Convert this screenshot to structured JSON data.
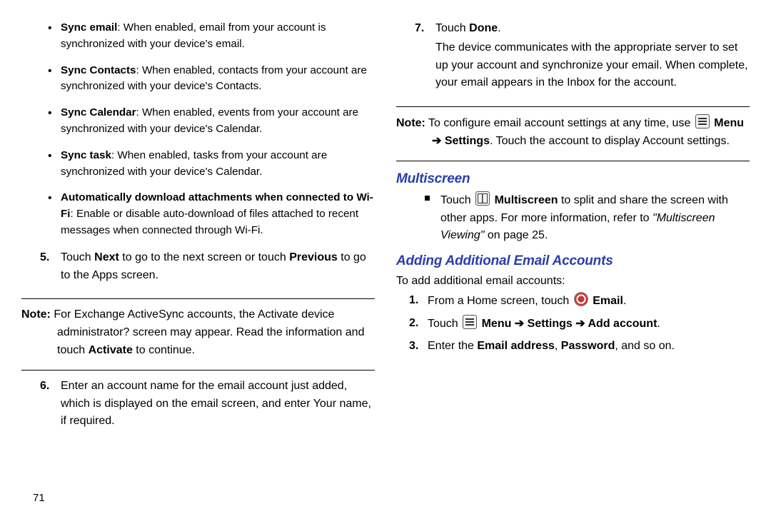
{
  "pageNumber": "71",
  "left": {
    "bullets": [
      {
        "bold": "Sync email",
        "rest": ": When enabled, email from your account is synchronized with your device's email."
      },
      {
        "bold": "Sync Contacts",
        "rest": ": When enabled, contacts from your account are synchronized with your device's Contacts."
      },
      {
        "bold": "Sync Calendar",
        "rest": ": When enabled, events from your account are synchronized with your device's Calendar."
      },
      {
        "bold": "Sync task",
        "rest": ": When enabled, tasks from your account are synchronized with your device's Calendar."
      },
      {
        "bold": "Automatically download attachments when connected to Wi-Fi",
        "rest": ": Enable or disable auto-download of files attached to recent messages when connected through Wi-Fi."
      }
    ],
    "step5": {
      "num": "5.",
      "pre": "Touch ",
      "b1": "Next",
      "mid": " to go to the next screen or touch ",
      "b2": "Previous",
      "post": " to go to the Apps screen."
    },
    "note1": {
      "label": "Note:",
      "pre": " For Exchange ActiveSync accounts, the Activate device administrator? screen may appear. Read the information and touch ",
      "b": "Activate",
      "post": " to continue."
    },
    "step6": {
      "num": "6.",
      "text": "Enter an account name for the email account just added, which is displayed on the email screen, and enter Your name, if required."
    }
  },
  "right": {
    "step7": {
      "num": "7.",
      "pre": "Touch ",
      "b": "Done",
      "post": ".",
      "body": "The device communicates with the appropriate server to set up your account and synchronize your email. When complete, your email appears in the Inbox for the account."
    },
    "note2": {
      "label": "Note:",
      "pre": " To configure email account settings at any time, use ",
      "bMenu": "Menu",
      "arrow": " ➔ ",
      "bSettings": "Settings",
      "post": ". Touch the account to display Account settings."
    },
    "headingMultiscreen": "Multiscreen",
    "multiscreen": {
      "pre": "Touch ",
      "b": "Multiscreen",
      "mid": " to split and share the screen with other apps. For more information, refer to ",
      "ref": "\"Multiscreen Viewing\"",
      "post": " on page 25."
    },
    "headingAdding": "Adding Additional Email Accounts",
    "addingIntro": "To add additional email accounts:",
    "add1": {
      "num": "1.",
      "pre": "From a Home screen, touch ",
      "b": "Email",
      "post": "."
    },
    "add2": {
      "num": "2.",
      "pre": "Touch ",
      "bMenu": "Menu",
      "arrow1": " ➔ ",
      "bSettings": "Settings",
      "arrow2": " ➔ ",
      "bAdd": "Add account",
      "post": "."
    },
    "add3": {
      "num": "3.",
      "pre": "Enter the ",
      "b1": "Email address",
      "sep": ", ",
      "b2": "Password",
      "post": ", and so on."
    }
  }
}
